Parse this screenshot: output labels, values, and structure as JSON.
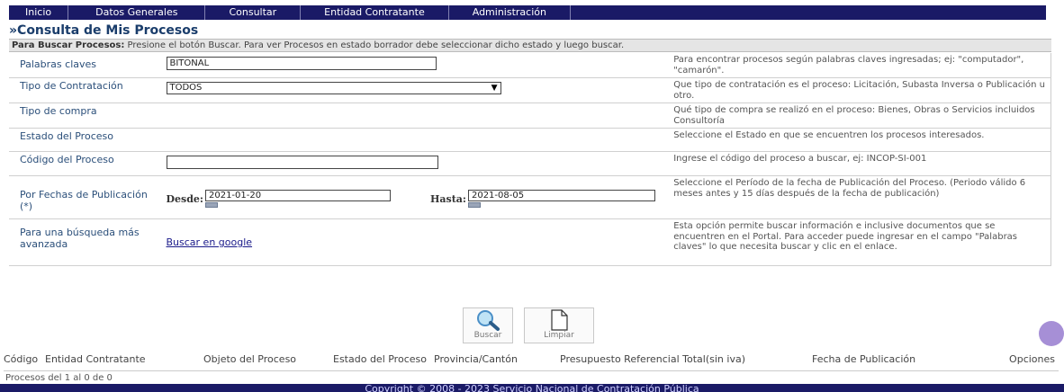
{
  "nav": {
    "items": [
      "Inicio",
      "Datos Generales",
      "Consultar",
      "Entidad Contratante",
      "Administración"
    ]
  },
  "page_title": "»Consulta de Mis Procesos",
  "instructions": {
    "bold": "Para Buscar Procesos:",
    "text": " Presione el botón Buscar. Para ver Procesos en estado borrador debe seleccionar dicho estado y luego buscar."
  },
  "form": {
    "keywords": {
      "label": "Palabras claves",
      "value": "BITONAL",
      "help": "Para encontrar procesos según palabras claves ingresadas; ej: \"computador\", \"camarón\"."
    },
    "contract_type": {
      "label": "Tipo de Contratación",
      "value": "TODOS",
      "help": "Que tipo de contratación es el proceso: Licitación, Subasta Inversa o Publicación u otro."
    },
    "purchase_type": {
      "label": "Tipo de compra",
      "help": "Qué tipo de compra se realizó en el proceso: Bienes, Obras o Servicios incluidos Consultoría"
    },
    "process_state": {
      "label": "Estado del Proceso",
      "help": "Seleccione el Estado en que se encuentren los procesos interesados."
    },
    "process_code": {
      "label": "Código del Proceso",
      "value": "",
      "help": "Ingrese el código del proceso a buscar, ej: INCOP-SI-001"
    },
    "dates": {
      "label": "Por Fechas de Publicación (*)",
      "from_label": "Desde:",
      "from_value": "2021-01-20",
      "to_label": "Hasta:",
      "to_value": "2021-08-05",
      "help": "Seleccione el Período de la fecha de Publicación del Proceso. (Periodo válido 6 meses antes y 15 días después de la fecha de publicación)"
    },
    "advanced": {
      "label": "Para una búsqueda más avanzada",
      "link": "Buscar en google",
      "help": "Esta opción permite buscar información e inclusive documentos que se encuentren en el Portal. Para acceder puede ingresar en el campo \"Palabras claves\" lo que necesita buscar y clic en el enlace."
    }
  },
  "buttons": {
    "search": "Buscar",
    "clear": "Limpiar"
  },
  "results": {
    "columns": [
      "Código",
      "Entidad Contratante",
      "Objeto del Proceso",
      "Estado del Proceso",
      "Provincia/Cantón",
      "Presupuesto Referencial Total(sin iva)",
      "Fecha de Publicación",
      "Opciones"
    ],
    "count_text": "Procesos del 1 al 0 de 0"
  },
  "footer": {
    "text": "Copyright © 2008 - 2023 Servicio Nacional de Contratación Pública"
  },
  "colors": {
    "nav_bg": "#1a1a66",
    "title": "#1a3d6b",
    "label": "#2b4f7a",
    "link": "#1a1a8a"
  }
}
